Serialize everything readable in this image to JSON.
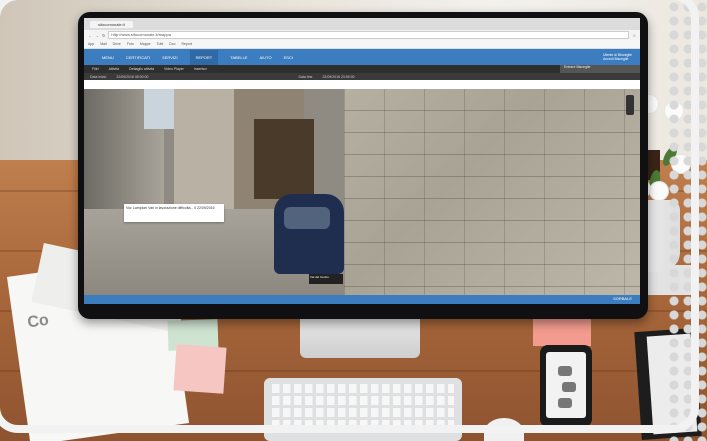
{
  "scene": {
    "description_label": "Desk with monitor showing web GIS street view",
    "colors": {
      "app_accent": "#3c7dbf",
      "desk": "#a9683b",
      "sticky_pink": "#f6c6c3",
      "sticky_salmon": "#f29b8e"
    }
  },
  "browser": {
    "tab_title": "sitocomunale.it",
    "url": "http://www.sitocomunale.it/mappa",
    "bookmarks": [
      "App",
      "Mail",
      "Drive",
      "Foto",
      "Mappe",
      "Tutti",
      "Doc",
      "Report"
    ]
  },
  "app": {
    "nav": [
      "MENU",
      "CERTIFICATI",
      "SERVIZI",
      "REPORT",
      "TABELLE",
      "AIUTO",
      "ESCI"
    ],
    "active_nav": "REPORT",
    "user_line1": "Utente di Bisceglie",
    "user_line2": "Accedi Bisceglie",
    "user_line3": "Entrare Bisceglie",
    "sub_tabs": [
      "Filtri",
      "Attività",
      "Dettaglio attività",
      "Video Player",
      "Inserisci"
    ],
    "filter_label": "Data inizio",
    "filter_value": "22/09/2016 08:00:00",
    "filter_end_label": "Data fine",
    "filter_end_value": "22/09/2016 23:59:00",
    "infobox_text": "Via: Lampioni Vari in lavorazione difficoltà... Il 22/09/2016",
    "sv_caption": "Via del Centro",
    "footer_logo": "SORBALE"
  },
  "paper": {
    "title": "Co"
  }
}
